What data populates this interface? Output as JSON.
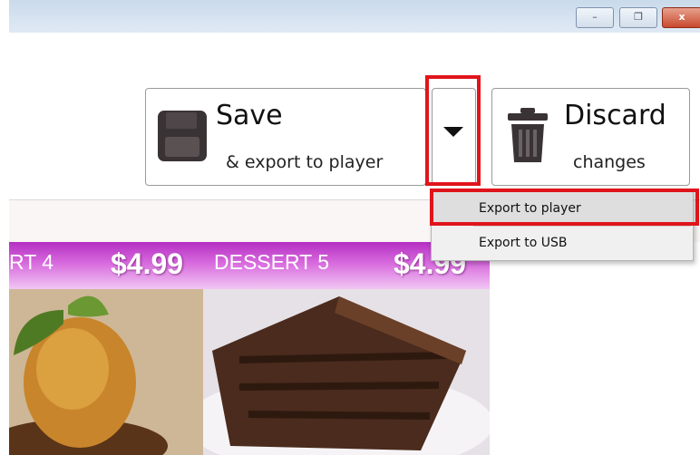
{
  "window": {
    "controls": {
      "minimize": "–",
      "maximize": "❐",
      "close": "x"
    }
  },
  "toolbar": {
    "save": {
      "title": "Save",
      "subtitle": "& export to player",
      "icon": "floppy-disk-icon"
    },
    "dropdown": {
      "icon": "dropdown-arrow-icon"
    },
    "discard": {
      "title": "Discard",
      "subtitle": "changes",
      "icon": "trash-can-icon"
    }
  },
  "menu": {
    "items": [
      {
        "label": "Export to player",
        "highlighted": true
      },
      {
        "label": "Export to USB",
        "highlighted": false
      }
    ]
  },
  "menu_board": {
    "items": [
      {
        "name": "RT 4",
        "price": "$4.99"
      },
      {
        "name": "DESSERT 5",
        "price": "$4.99"
      }
    ],
    "banner_color": "#c74fd0"
  },
  "colors": {
    "highlight": "#e0141b",
    "menu_background": "#f0f0f0"
  }
}
